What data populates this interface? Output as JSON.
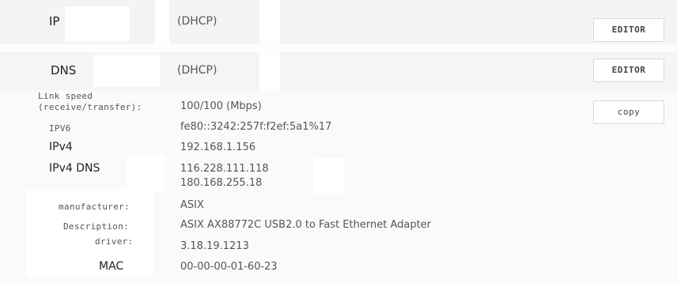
{
  "ip": {
    "label": "IP",
    "value": "(DHCP)",
    "button": "EDITOR"
  },
  "dns": {
    "label": "DNS",
    "value": "(DHCP)",
    "button": "EDITOR"
  },
  "details": {
    "copy_button": "copy",
    "link_speed": {
      "label_line1": "Link speed",
      "label_line2": "(receive/transfer):",
      "value": "100/100 (Mbps)"
    },
    "ipv6": {
      "label": "IPV6",
      "value": "fe80::3242:257f:f2ef:5a1%17"
    },
    "ipv4": {
      "label": "IPv4",
      "value": "192.168.1.156"
    },
    "ipv4_dns": {
      "label": "IPv4 DNS",
      "values": [
        "116.228.111.118",
        "180.168.255.18"
      ]
    },
    "manufacturer": {
      "label": "manufacturer:",
      "value": "ASIX"
    },
    "description": {
      "label": "Description:",
      "value": "ASIX AX88772C USB2.0 to Fast Ethernet Adapter"
    },
    "driver": {
      "label": "driver:",
      "value": "3.18.19.1213"
    },
    "mac": {
      "label": "MAC",
      "value": "00-00-00-01-60-23"
    }
  }
}
